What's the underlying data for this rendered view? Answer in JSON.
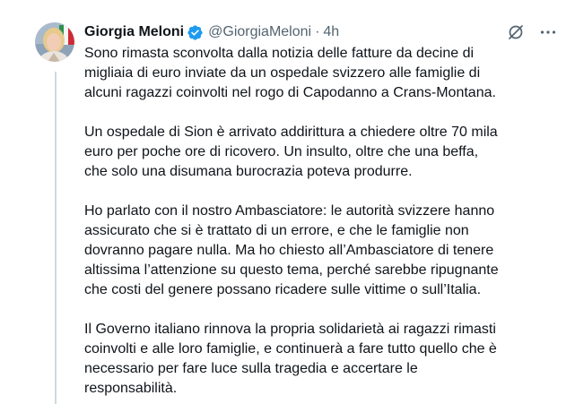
{
  "tweet": {
    "author": {
      "display_name": "Giorgia Meloni",
      "handle": "@GiorgiaMeloni",
      "verified": true,
      "verified_color": "#1d9bf0"
    },
    "separator": "·",
    "timestamp": "4h",
    "icons": {
      "avatar": "avatar-photo",
      "verified": "verified-badge-icon",
      "grok": "grok-icon",
      "more": "more-options-icon"
    },
    "paragraphs": [
      [
        "Sono rimasta sconvolta dalla notizia delle fatture da decine di",
        "migliaia di euro inviate da un ospedale svizzero alle famiglie di",
        "alcuni ragazzi coinvolti nel rogo di Capodanno a Crans-Montana."
      ],
      [
        "Un ospedale di Sion è arrivato addirittura a chiedere oltre 70 mila",
        "euro per poche ore di ricovero. Un insulto, oltre che una beffa,",
        "che solo una disumana burocrazia poteva produrre."
      ],
      [
        "Ho parlato con il nostro Ambasciatore: le autorità svizzere hanno",
        "assicurato che si è trattato di un errore, e che le famiglie non",
        "dovranno pagare nulla. Ma ho chiesto all’Ambasciatore di tenere",
        "altissima l’attenzione su questo tema, perché sarebbe ripugnante",
        "che costi del genere possano ricadere sulle vittime o sull’Italia."
      ],
      [
        "Il Governo italiano rinnova la propria solidarietà ai ragazzi rimasti",
        "coinvolti e alle loro famiglie, e continuerà a fare tutto quello che è",
        "necessario per fare luce sulla tragedia e accertare le",
        "responsabilità."
      ]
    ]
  },
  "colors": {
    "text_primary": "#0f1419",
    "text_secondary": "#536471",
    "thread_line": "#cfd9de",
    "verified": "#1d9bf0"
  }
}
